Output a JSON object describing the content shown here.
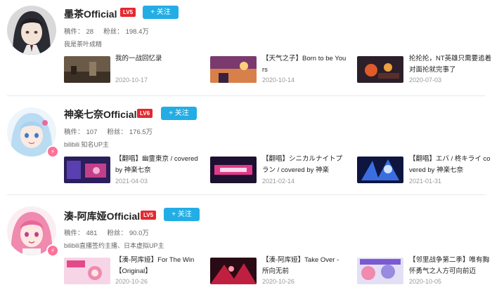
{
  "users": [
    {
      "name": "墨茶Official",
      "level": "LV5",
      "follow_label": "+ 关注",
      "stats": {
        "posts_label": "稿件：",
        "posts": "28",
        "fans_label": "粉丝：",
        "fans": "198.4万"
      },
      "sign": "我是茶叶成精",
      "verified": false,
      "videos": [
        {
          "title": "我的一战回忆录",
          "date": "2020-10-17"
        },
        {
          "title": "【天气之子】Born to be Yours",
          "date": "2020-10-14"
        },
        {
          "title": "抡抡抡，NT英雄只需要追着对面抡就完事了",
          "date": "2020-07-03"
        }
      ]
    },
    {
      "name": "神楽七奈Official",
      "level": "LV6",
      "follow_label": "+ 关注",
      "stats": {
        "posts_label": "稿件：",
        "posts": "107",
        "fans_label": "粉丝：",
        "fans": "176.5万"
      },
      "sign": "bilibili 知名UP主",
      "verified": true,
      "videos": [
        {
          "title": "【翻唱】幽霊東京 / covered by 神楽七奈",
          "date": "2021-04-03"
        },
        {
          "title": "【翻唱】シニカルナイトプラン / covered by 神楽",
          "date": "2021-02-14"
        },
        {
          "title": "【翻唱】エバ / 柊キライ covered by 神楽七奈",
          "date": "2021-01-31"
        }
      ]
    },
    {
      "name": "湊-阿库娅Official",
      "level": "LV5",
      "follow_label": "+ 关注",
      "stats": {
        "posts_label": "稿件：",
        "posts": "481",
        "fans_label": "粉丝：",
        "fans": "90.0万"
      },
      "sign": "bilibili直播签约主播、日本虚拟UP主",
      "verified": true,
      "videos": [
        {
          "title": "【湊-阿库娅】For The Win【Original】",
          "date": "2020-10-26"
        },
        {
          "title": "【湊-阿库娅】Take Over - 所向无前",
          "date": "2020-10-26"
        },
        {
          "title": "【邻里战争第二季】唯有胸怀勇气之人方可向前迈",
          "date": "2020-10-05"
        }
      ]
    }
  ],
  "colors": {
    "level_badge": "#e5282f",
    "follow_button": "#23ade5",
    "verified_badge": "#fb7299",
    "divider": "#e5e9ef"
  }
}
